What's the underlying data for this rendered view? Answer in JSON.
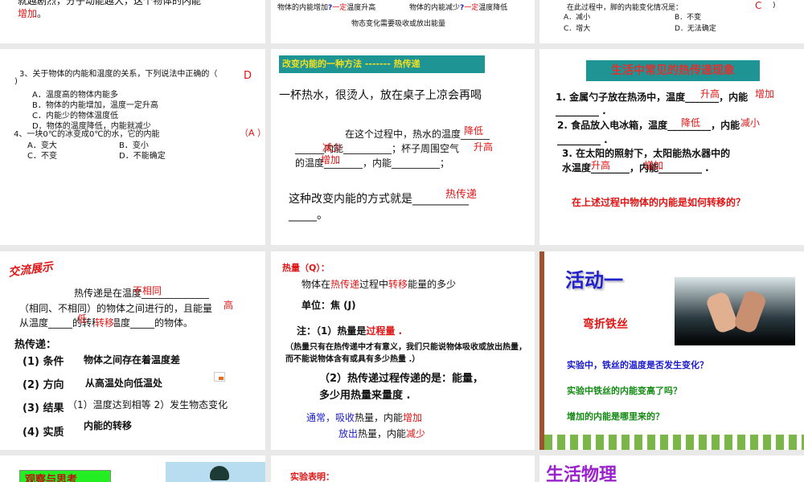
{
  "slides": [
    {
      "line1": "就越剧烈，分子动能越大，这个物体的内能",
      "line2_red": "增加",
      "line2_end": "。"
    },
    {
      "t1": "物体的内能增加",
      "q": "?",
      "d": "一定",
      "t2": "温度升高",
      "t3": "物体的内能减少",
      "t4": "温度降低",
      "t5": "物态变化需要吸收或放出能量"
    },
    {
      "q": "在此过程中，脚的内能变化情况是：",
      "ans": "C",
      "paren": ")",
      "a": "A．减小",
      "b": "B．不变",
      "c": "C．增大",
      "d": "D．无法确定"
    },
    {
      "q3": "3、关于物体的内能和温度的关系，下列说法中正确的（",
      "q3b": ")",
      "ans3": "D",
      "opts3": [
        "A．温度高的物体内能多",
        "B．物体的内能增加，温度一定升高",
        "C．内能少的物体温度低",
        "D．物体的温度降低，内能就减少"
      ],
      "q4": "4、一块0℃的冰变成0℃的水，它的内能",
      "ans4": "（A ）",
      "opts4": [
        "A．变大",
        "B．变小",
        "C．不变",
        "D．不能确定"
      ]
    },
    {
      "title": "改变内能的一种方法 ------- 热传递",
      "p1": "一杯热水，很烫人，放在桌子上凉会再喝",
      "p2": "在这个过程中，热水的温度______",
      "p3": "______内能__________；杯子周围空气",
      "p4": "的温度________，内能__________；",
      "p5": "这种改变内能的方式就是__________",
      "p6": "_____。",
      "a1": "降低",
      "a2": "减少",
      "a3": "升高",
      "a4": "增加",
      "a5": "热传递"
    },
    {
      "title": "生活中常见的热传递现象",
      "l1": "1. 金属勺子放在热汤中，温度_______，内能",
      "l1b": "_________ .",
      "l2": "2. 食品放入电冰箱，温度_________，内能",
      "l2b": "_________ .",
      "l3": "3. 在太阳的照射下，太阳能热水器中的",
      "l4": "水温度________，内能_________ .",
      "a1": "升高",
      "a2": "增加",
      "a3": "降低",
      "a4": "减小",
      "a5": "升高",
      "a6": "增加",
      "question": "在上述过程中物体的内能是如何转移的？"
    },
    {
      "logo": "交流展示",
      "p1": "热传递是在温度______________",
      "p2": "（相同、不相同）的物体之间进行的，且能量",
      "p3": "从温度_____的转移到温度_____的物体。",
      "a1": "不相同",
      "a2": "高",
      "a3": "低",
      "move": "转移",
      "h": "热传递：",
      "items": [
        {
          "k": "(1) 条件",
          "v": "物体之间存在着温度差"
        },
        {
          "k": "(2) 方向",
          "v": "从高温处向低温处"
        },
        {
          "k": "(3) 结果",
          "v": "（1）温度达到相等 2）发生物态变化"
        },
        {
          "k": "(4) 实质",
          "v": "内能的转移"
        }
      ]
    },
    {
      "h": "热量（Q）：",
      "d1": "物体在",
      "d2": "热传递",
      "d3": "过程中",
      "d4": "转移",
      "d5": "能量的多少",
      "unit": "单位：焦 (J)",
      "n1": "注：（1）热量是",
      "n1r": "过程量 .",
      "n2": "（热量只有在热传递中才有意义，我们只能说物体吸收或放出热量，而不能说物体含有或具有多少热量 .）",
      "n3": "（2）热传递过程传递的是：能量，",
      "n4": "多少用热量来量度 .",
      "u1": "通常，吸收",
      "u1b": "热量，内能",
      "u1r": "增加",
      "u2": "放出",
      "u2b": "热量，内能",
      "u2r": "减少"
    },
    {
      "title": "活动一",
      "sub": "弯折铁丝",
      "q1": "实验中，铁丝的温度是否发生变化？",
      "q2": "实验中铁丝的内能变高了吗？",
      "q3": "增加的内能是哪里来的？"
    },
    {
      "title": "观察与思考"
    },
    {
      "title": "实验表明："
    },
    {
      "title": "生活物理"
    }
  ]
}
